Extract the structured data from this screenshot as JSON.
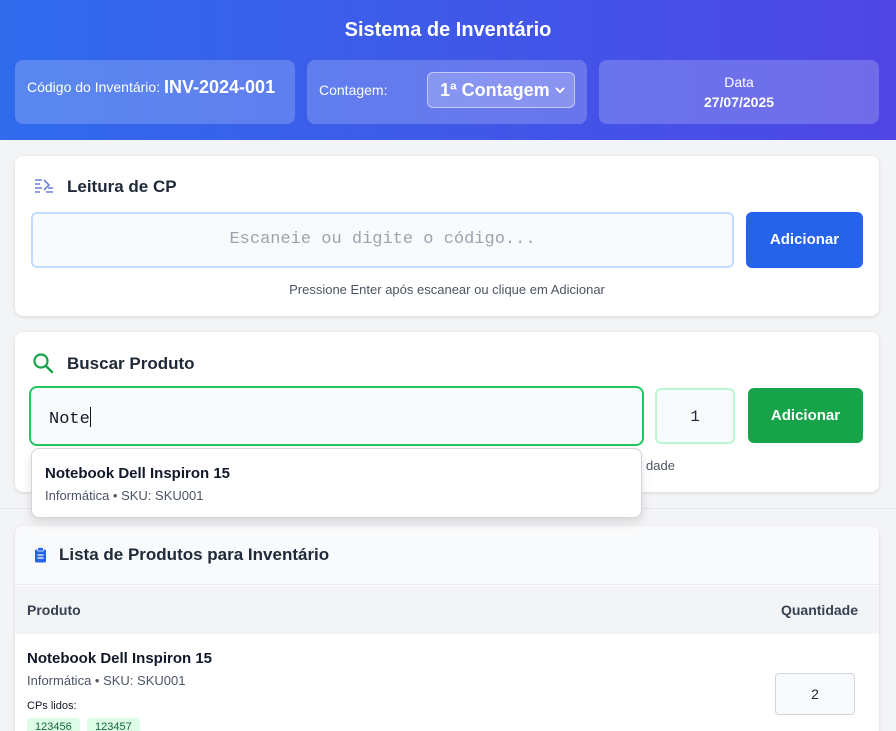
{
  "header": {
    "title": "Sistema de Inventário",
    "inventory_code_label": "Código do Inventário:",
    "inventory_code_value": "INV-2024-001",
    "count_label": "Contagem:",
    "count_selected": "1ª Contagem",
    "date_label": "Data",
    "date_value": "27/07/2025"
  },
  "cp_reader": {
    "icon": "barcode-icon",
    "title": "Leitura de CP",
    "placeholder": "Escaneie ou digite o código...",
    "add_button": "Adicionar",
    "hint": "Pressione Enter após escanear ou clique em Adicionar"
  },
  "product_search": {
    "icon": "search-icon",
    "title": "Buscar Produto",
    "query": "Note",
    "quantity": "1",
    "add_button": "Adicionar",
    "hint_visible_fragment": "dade",
    "suggestions": [
      {
        "name": "Notebook Dell Inspiron 15",
        "meta": "Informática • SKU: SKU001"
      }
    ]
  },
  "inventory_list": {
    "icon": "clipboard-icon",
    "title": "Lista de Produtos para Inventário",
    "columns": [
      "Produto",
      "Quantidade"
    ],
    "rows": [
      {
        "name": "Notebook Dell Inspiron 15",
        "meta": "Informática • SKU: SKU001",
        "cps_label": "CPs lidos:",
        "cps": [
          "123456",
          "123457"
        ],
        "quantity": "2"
      }
    ]
  },
  "colors": {
    "header_gradient_start": "#2f6bec",
    "header_gradient_end": "#4f46e5",
    "primary_button": "#2563eb",
    "success_button": "#16a34a",
    "tag_bg": "#dcfce7"
  }
}
